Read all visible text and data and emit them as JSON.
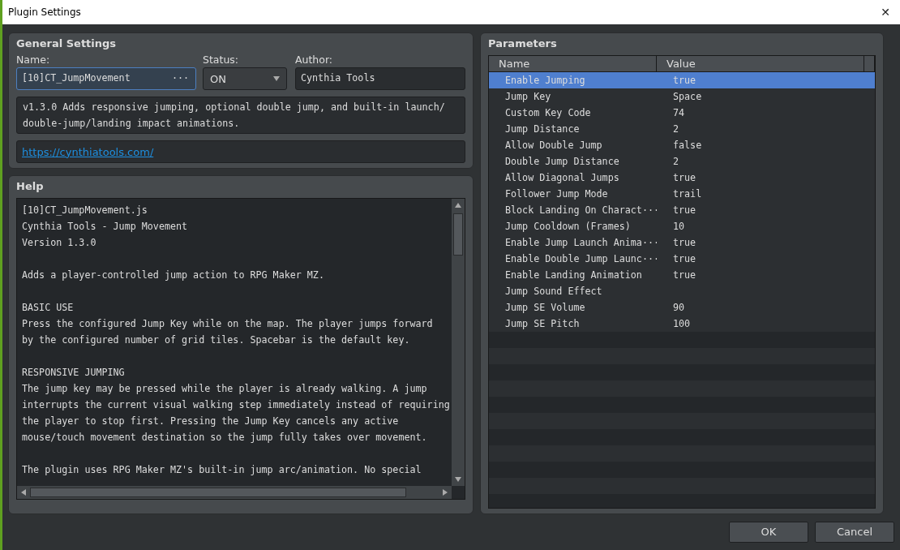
{
  "window": {
    "title": "Plugin Settings",
    "close": "✕"
  },
  "general": {
    "title": "General Settings",
    "name": {
      "label": "Name:",
      "value": "[10]CT_JumpMovement",
      "button": "···"
    },
    "status": {
      "label": "Status:",
      "value": "ON"
    },
    "author": {
      "label": "Author:",
      "value": "Cynthia Tools"
    },
    "description": "v1.3.0 Adds responsive jumping, optional double jump, and built-in launch/\ndouble-jump/landing impact animations.",
    "url": "https://cynthiatools.com/"
  },
  "help": {
    "title": "Help",
    "paragraphs": [
      [
        "[10]CT_JumpMovement.js",
        "Cynthia Tools - Jump Movement",
        "Version 1.3.0"
      ],
      [
        "Adds a player-controlled jump action to RPG Maker MZ."
      ],
      [
        "BASIC USE",
        "Press the configured Jump Key while on the map. The player jumps forward",
        "by the configured number of grid tiles. Spacebar is the default key."
      ],
      [
        "RESPONSIVE JUMPING",
        "The jump key may be pressed while the player is already walking. A jump",
        "interrupts the current visual walking step immediately instead of requiring",
        "the player to stop first. Pressing the Jump Key cancels any active",
        "mouse/touch movement destination so the jump fully takes over movement."
      ],
      [
        "The plugin uses RPG Maker MZ's built-in jump arc/animation. No special"
      ]
    ]
  },
  "parameters": {
    "title": "Parameters",
    "columns": [
      "Name",
      "Value"
    ],
    "rows": [
      {
        "name": "Enable Jumping",
        "value": "true",
        "selected": true
      },
      {
        "name": "Jump Key",
        "value": "Space",
        "selected": false
      },
      {
        "name": "Custom Key Code",
        "value": "74",
        "selected": false
      },
      {
        "name": "Jump Distance",
        "value": "2",
        "selected": false
      },
      {
        "name": "Allow Double Jump",
        "value": "false",
        "selected": false
      },
      {
        "name": "Double Jump Distance",
        "value": "2",
        "selected": false
      },
      {
        "name": "Allow Diagonal Jumps",
        "value": "true",
        "selected": false
      },
      {
        "name": "Follower Jump Mode",
        "value": "trail",
        "selected": false
      },
      {
        "name": "Block Landing On Charact···",
        "value": "true",
        "selected": false
      },
      {
        "name": "Jump Cooldown (Frames)",
        "value": "10",
        "selected": false
      },
      {
        "name": "Enable Jump Launch Anima···",
        "value": "true",
        "selected": false
      },
      {
        "name": "Enable Double Jump Launc···",
        "value": "true",
        "selected": false
      },
      {
        "name": "Enable Landing Animation",
        "value": "true",
        "selected": false
      },
      {
        "name": "Jump Sound Effect",
        "selected": false
      },
      {
        "name": "Jump SE Volume",
        "value": "90",
        "selected": false
      },
      {
        "name": "Jump SE Pitch",
        "value": "100",
        "selected": false
      }
    ]
  },
  "buttons": [
    "OK",
    "Cancel"
  ]
}
